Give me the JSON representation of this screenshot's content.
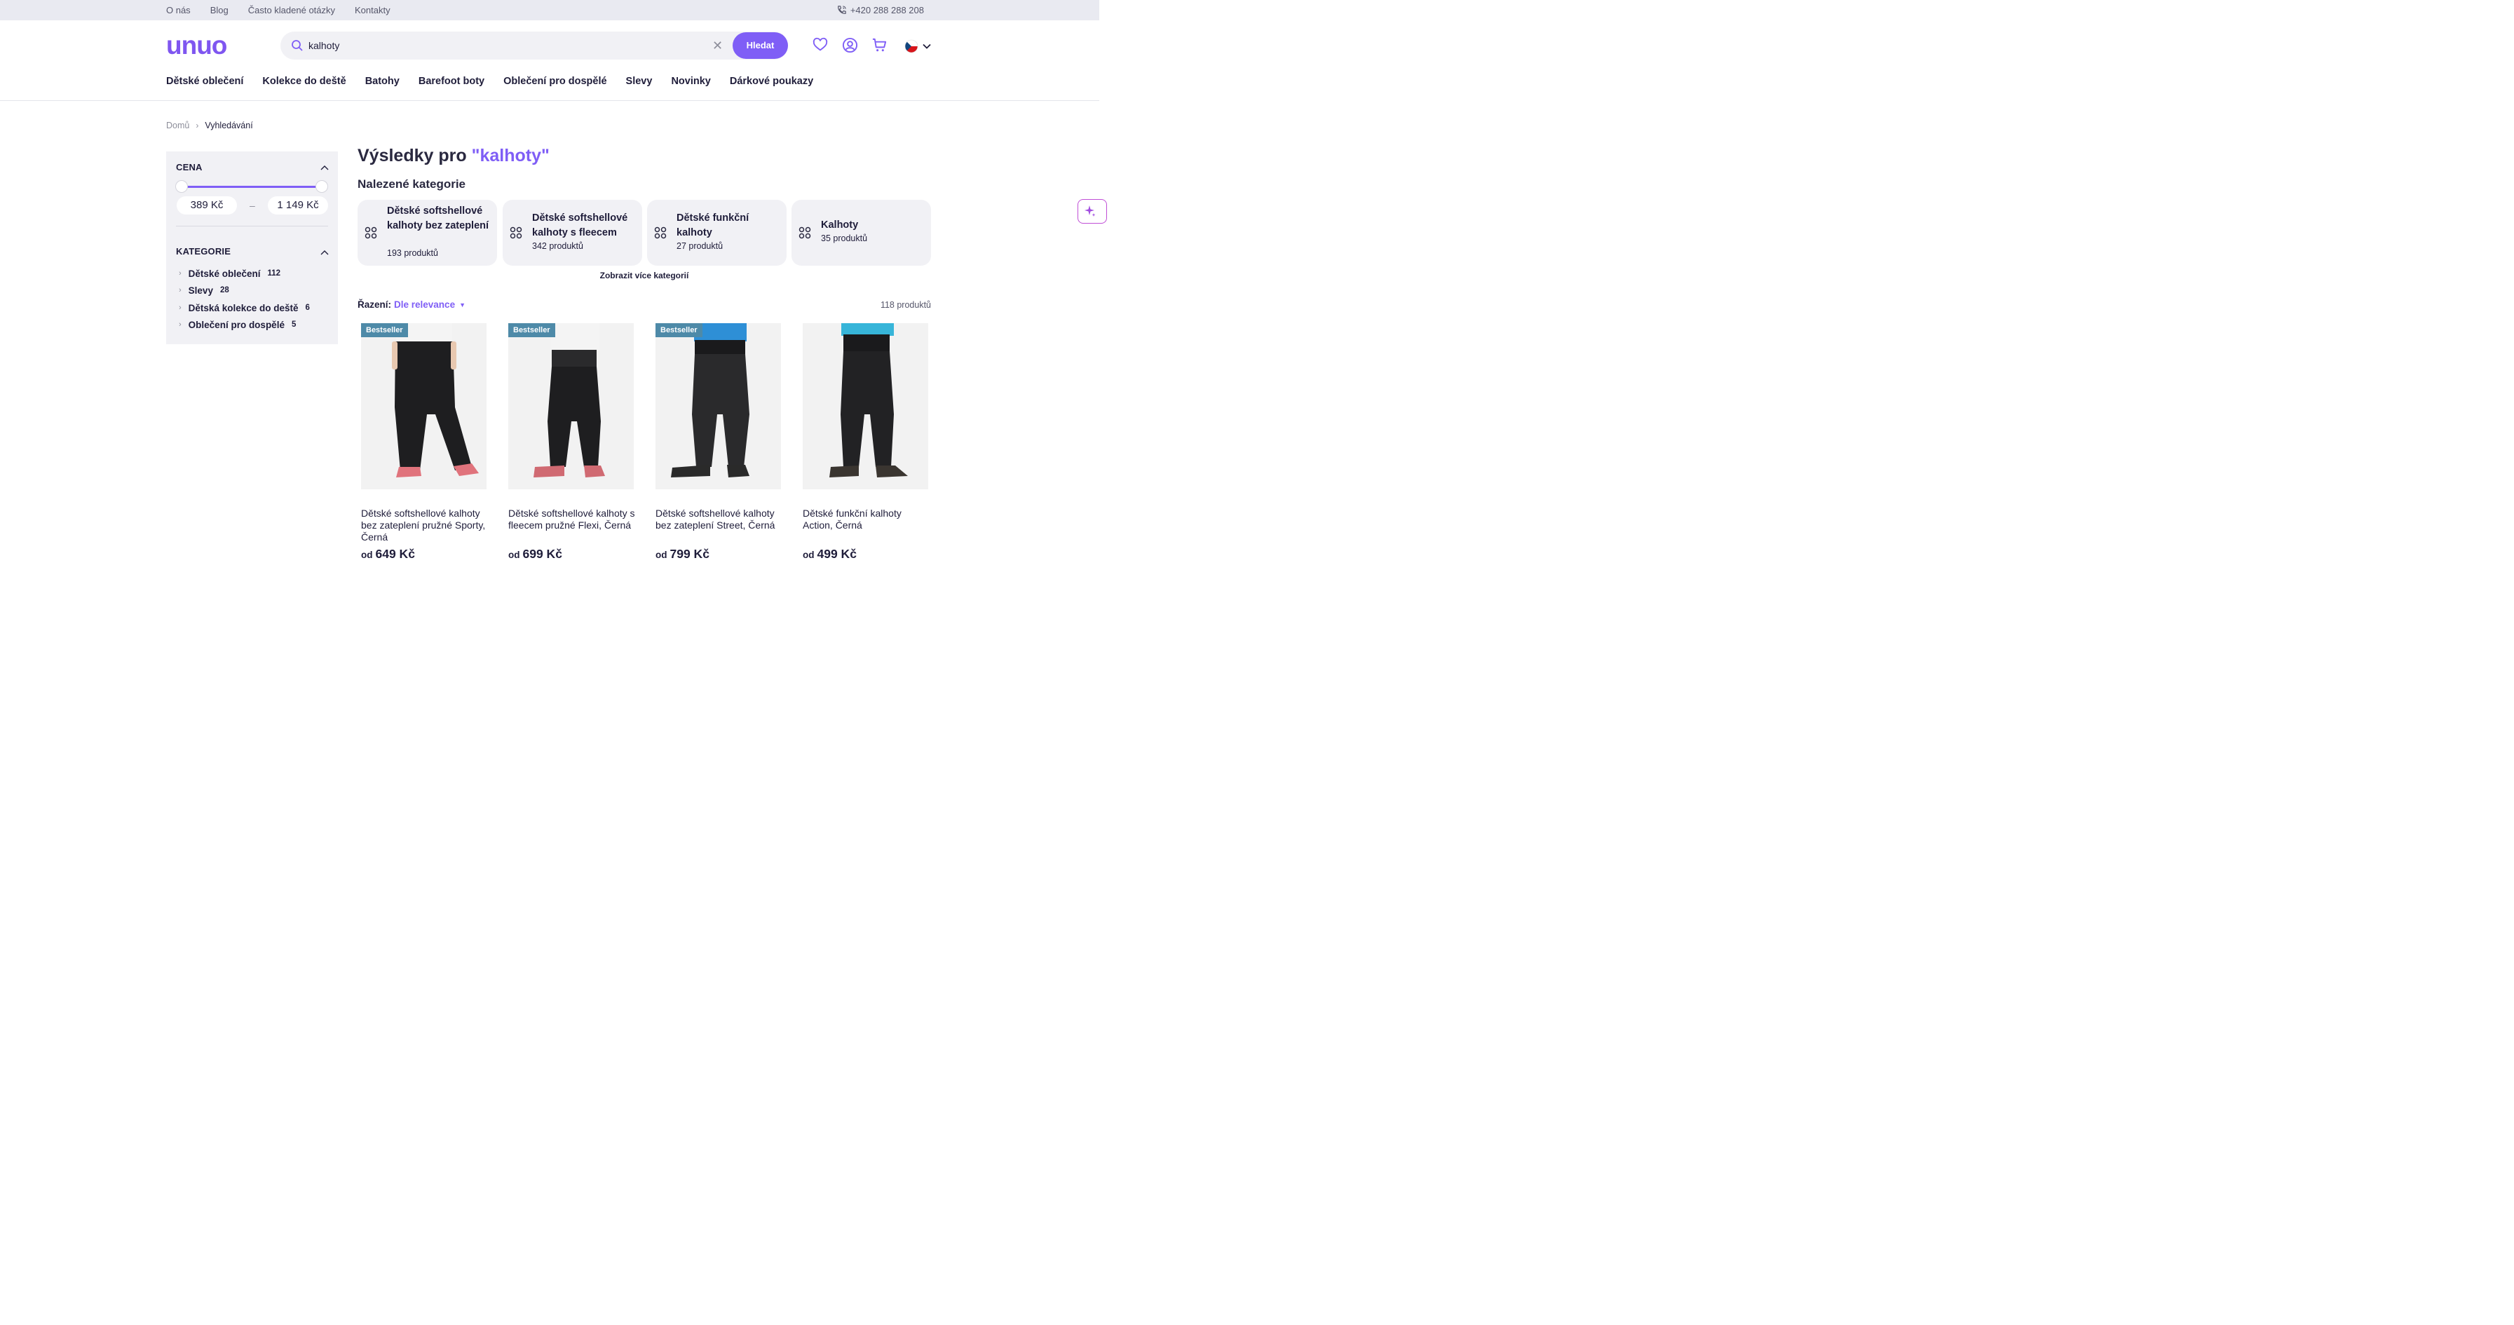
{
  "topbar": {
    "links": [
      "O nás",
      "Blog",
      "Často kladené otázky",
      "Kontakty"
    ],
    "phone": "+420 288 288 208"
  },
  "header": {
    "logo": "unuo",
    "search_value": "kalhoty",
    "search_button": "Hledat",
    "language": "cz-flag"
  },
  "nav": [
    "Dětské oblečení",
    "Kolekce do deště",
    "Batohy",
    "Barefoot boty",
    "Oblečení pro dospělé",
    "Slevy",
    "Novinky",
    "Dárkové poukazy"
  ],
  "breadcrumb": {
    "home": "Domů",
    "current": "Vyhledávání"
  },
  "filters": {
    "price_heading": "CENA",
    "price_min": "389 Kč",
    "price_max": "1 149 Kč",
    "price_separator": "–",
    "category_heading": "KATEGORIE",
    "categories": [
      {
        "label": "Dětské oblečení",
        "count": "112"
      },
      {
        "label": "Slevy",
        "count": "28"
      },
      {
        "label": "Dětská kolekce do deště",
        "count": "6"
      },
      {
        "label": "Oblečení pro dospělé",
        "count": "5"
      }
    ]
  },
  "results": {
    "title_prefix": "Výsledky pro",
    "query": "\"kalhoty\"",
    "found_categories_heading": "Nalezené kategorie",
    "category_cards": [
      {
        "title": "Dětské softshellové kalhoty bez zateplení",
        "count": "193 produktů"
      },
      {
        "title": "Dětské softshellové kalhoty s fleecem",
        "count": "342 produktů"
      },
      {
        "title": "Dětské funkční kalhoty",
        "count": "27 produktů"
      },
      {
        "title": "Kalhoty",
        "count": "35 produktů"
      }
    ],
    "more_categories": "Zobrazit více kategorií",
    "sort_label": "Řazení:",
    "sort_value": "Dle relevance",
    "total": "118 produktů"
  },
  "products": [
    {
      "badge": "Bestseller",
      "name": "Dětské softshellové kalhoty bez zateplení pružné Sporty, Černá",
      "from": "od",
      "price": "649 Kč",
      "shoe_color": "#e0737c",
      "shirt_color": "#f4f4f4"
    },
    {
      "badge": "Bestseller",
      "name": "Dětské softshellové kalhoty s fleecem pružné Flexi, Černá",
      "from": "od",
      "price": "699 Kč",
      "shoe_color": "#d06a72",
      "shirt_color": "#f4f4f4"
    },
    {
      "badge": "Bestseller",
      "name": "Dětské softshellové kalhoty bez zateplení Street, Černá",
      "from": "od",
      "price": "799 Kč",
      "shoe_color": "#2a2a2a",
      "shirt_color": "#2e8fd6"
    },
    {
      "badge": "",
      "name": "Dětské funkční kalhoty Action, Černá",
      "from": "od",
      "price": "499 Kč",
      "shoe_color": "#3a3530",
      "shirt_color": "#37b5d9"
    }
  ],
  "colors": {
    "accent": "#7f5ef6",
    "badge": "#4e8aa8"
  }
}
